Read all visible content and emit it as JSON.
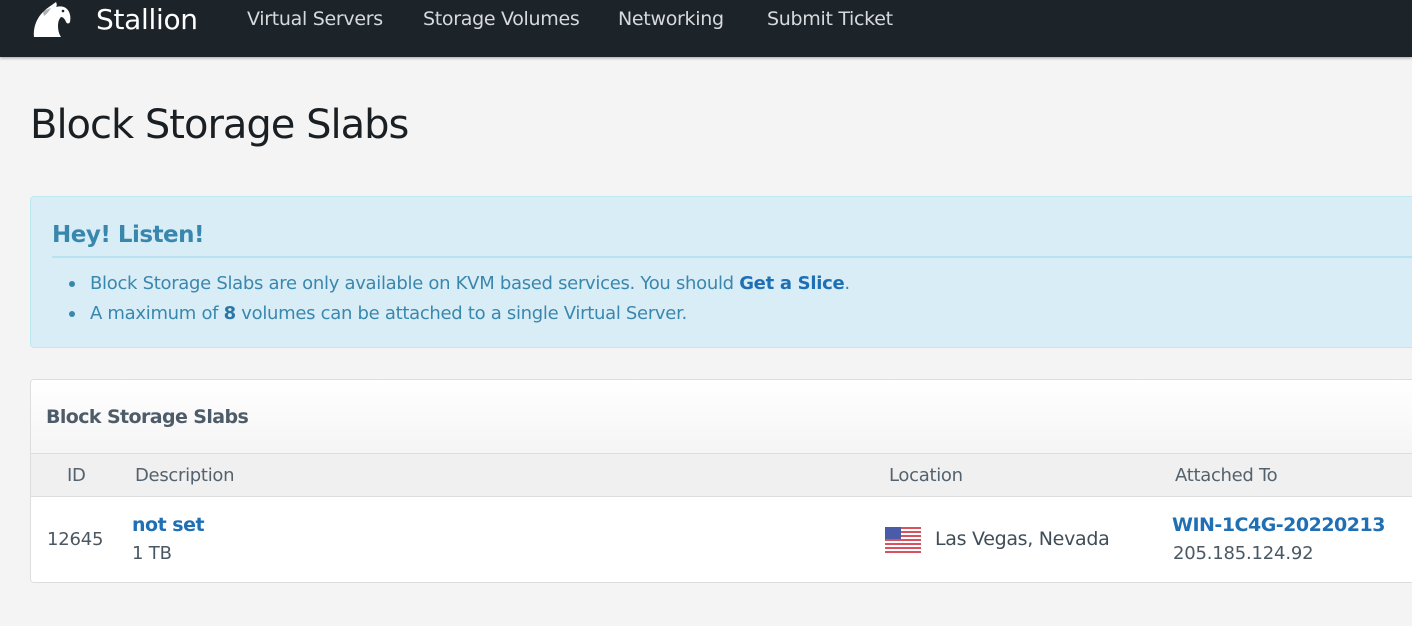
{
  "navbar": {
    "brand_name": "Stallion",
    "items": [
      {
        "label": "Virtual Servers"
      },
      {
        "label": "Storage Volumes"
      },
      {
        "label": "Networking"
      },
      {
        "label": "Submit Ticket"
      }
    ]
  },
  "page": {
    "title": "Block Storage Slabs"
  },
  "alert": {
    "heading": "Hey! Listen!",
    "item1": {
      "text": "Block Storage Slabs are only available on KVM based services. You should ",
      "link": "Get a Slice",
      "suffix": "."
    },
    "item2": {
      "prefix": "A maximum of ",
      "count": "8",
      "suffix": " volumes can be attached to a single Virtual Server."
    }
  },
  "panel": {
    "title": "Block Storage Slabs",
    "columns": {
      "id": "ID",
      "description": "Description",
      "location": "Location",
      "attached_to": "Attached To"
    },
    "rows": [
      {
        "id": "12645",
        "description": "not set",
        "size": "1 TB",
        "location": "Las Vegas, Nevada",
        "location_flag": "us-flag-icon",
        "attached_name": "WIN-1C4G-20220213",
        "attached_ip": "205.185.124.92"
      }
    ]
  },
  "colors": {
    "navbar_bg": "#1c2329",
    "alert_bg": "#d9edf7",
    "alert_text": "#3a87ad",
    "link": "#1f6fb5"
  }
}
